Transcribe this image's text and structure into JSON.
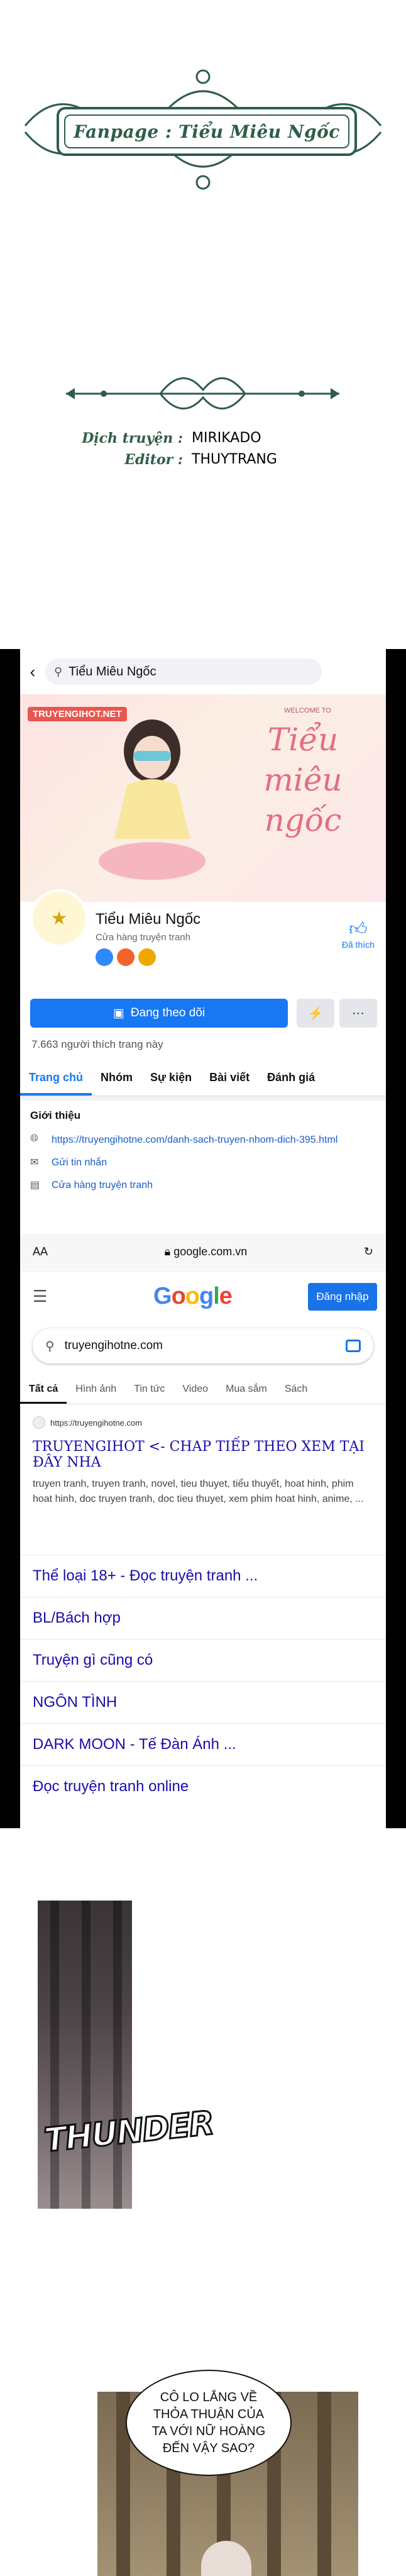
{
  "banner": {
    "text": "Fanpage : Tiểu Miêu Ngốc"
  },
  "credits": [
    {
      "key": "Dịch truyện :",
      "value": "MIRIKADO"
    },
    {
      "key": "Editor :",
      "value": "THUYTRANG"
    }
  ],
  "facebook": {
    "search_text": "Tiểu Miêu Ngốc",
    "cover_badge": "TRUYENGIHOT.NET",
    "cover_small": "WELCOME TO",
    "cover_title": "Tiểu miêu ngốc",
    "page_name": "Tiểu Miêu Ngốc",
    "page_category": "Cửa hàng truyện tranh",
    "liked_label": "Đã thích",
    "follow_label": "Đang theo dõi",
    "likes_count": "7.663 người thích trang này",
    "tabs": [
      "Trang chủ",
      "Nhóm",
      "Sự kiện",
      "Bài viết",
      "Đánh giá"
    ],
    "intro_title": "Giới thiệu",
    "intro_rows": [
      {
        "icon": "globe-icon",
        "text": "https://truyengihotne.com/danh-sach-truyen-nhom-dich-395.html"
      },
      {
        "icon": "messenger-icon",
        "text": "Gửi tin nhắn"
      },
      {
        "icon": "shop-icon",
        "text": "Cửa hàng truyện tranh"
      }
    ]
  },
  "safari": {
    "aa": "AA",
    "url": "google.com.vn"
  },
  "google": {
    "logo": "Google",
    "login_label": "Đăng nhập",
    "query": "truyengihotne.com",
    "tabs": [
      "Tất cả",
      "Hình ảnh",
      "Tin tức",
      "Video",
      "Mua sắm",
      "Sách"
    ],
    "result_url": "https://truyengihotne.com",
    "result_title": "TRUYENGIHOT <- CHAP TIẾP THEO XEM TẠI ĐÂY NHA",
    "result_snippet": "truyen tranh, truyen tranh, novel, tieu thuyet, tiểu thuyết, hoat hinh, phim hoat hinh, doc truyen tranh, doc tieu thuyet, xem phim hoat hinh, anime, ...",
    "links": [
      "Thể loại 18+ - Đọc truyện tranh ...",
      "BL/Bách hợp",
      "Truyện gì cũng có",
      "NGÔN TÌNH",
      "DARK MOON - Tế Đàn Ánh ...",
      "Đọc truyện tranh online"
    ]
  },
  "comic": {
    "sfx": "THUNDER",
    "speech": "CÔ LO LẮNG VỀ THỎA THUẬN CỦA TA VỚI NỮ HOÀNG ĐẾN VẬY SAO?"
  },
  "colors": {
    "accent_green": "#2f5e47",
    "facebook_blue": "#1877f2",
    "google_blue": "#1a73e8"
  }
}
